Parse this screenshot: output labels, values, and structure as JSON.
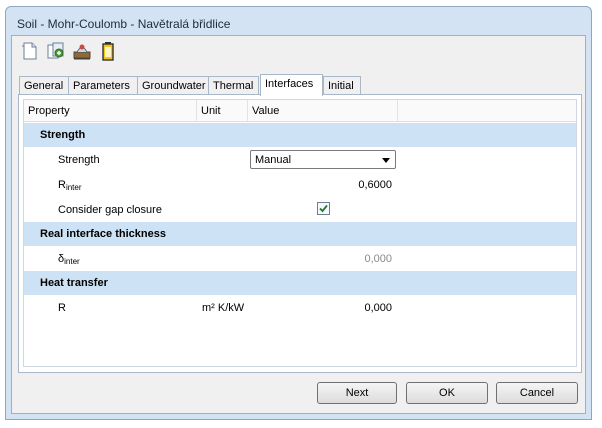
{
  "window": {
    "title": "Soil - Mohr-Coulomb - Navětralá břidlice"
  },
  "toolbar": {
    "icons": [
      "new-document-icon",
      "copy-document-icon",
      "soil-test-icon",
      "battery-icon"
    ]
  },
  "tabs": [
    {
      "label": "General"
    },
    {
      "label": "Parameters"
    },
    {
      "label": "Groundwater"
    },
    {
      "label": "Thermal"
    },
    {
      "label": "Interfaces",
      "active": true
    },
    {
      "label": "Initial"
    }
  ],
  "grid": {
    "headers": {
      "property": "Property",
      "unit": "Unit",
      "value": "Value"
    },
    "sections": {
      "strength": "Strength",
      "thickness": "Real interface thickness",
      "heat": "Heat transfer"
    },
    "rows": {
      "strength": {
        "label": "Strength",
        "value": "Manual"
      },
      "rinter": {
        "label_main": "R",
        "label_sub": "inter",
        "value": "0,6000"
      },
      "gap": {
        "label": "Consider gap closure",
        "checked": true
      },
      "dinter": {
        "label_main": "δ",
        "label_sub": "inter",
        "value": "0,000"
      },
      "r": {
        "label": "R",
        "unit": "m² K/kW",
        "value": "0,000"
      }
    }
  },
  "buttons": {
    "next": "Next",
    "ok": "OK",
    "cancel": "Cancel"
  },
  "colors": {
    "section_bg": "#cde3f5",
    "frame": "#d3e3f4",
    "check": "#1f7a2e"
  }
}
